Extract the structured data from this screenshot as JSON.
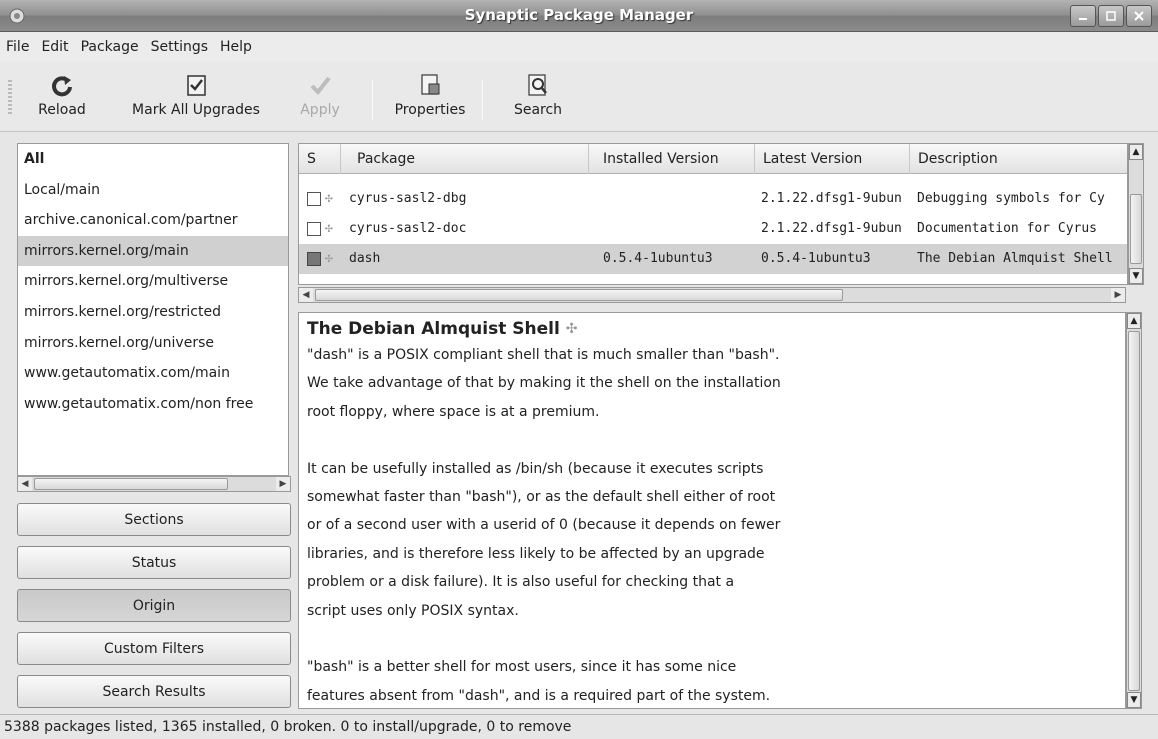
{
  "window": {
    "title": "Synaptic Package Manager"
  },
  "menubar": {
    "items": [
      "File",
      "Edit",
      "Package",
      "Settings",
      "Help"
    ]
  },
  "toolbar": {
    "reload": "Reload",
    "mark_all_upgrades": "Mark All Upgrades",
    "apply": "Apply",
    "properties": "Properties",
    "search": "Search"
  },
  "origins": {
    "selected": "mirrors.kernel.org/main",
    "items": [
      "All",
      "Local/main",
      "archive.canonical.com/partner",
      "mirrors.kernel.org/main",
      "mirrors.kernel.org/multiverse",
      "mirrors.kernel.org/restricted",
      "mirrors.kernel.org/universe",
      "www.getautomatix.com/main",
      "www.getautomatix.com/non free"
    ]
  },
  "filter_buttons": [
    "Sections",
    "Status",
    "Origin",
    "Custom Filters",
    "Search Results"
  ],
  "active_filter": "Origin",
  "packages": {
    "columns": [
      "S",
      "Package",
      "Installed Version",
      "Latest Version",
      "Description"
    ],
    "rows": [
      {
        "name": "cyrus-sasl2-dbg",
        "installed": "",
        "latest": "2.1.22.dfsg1-9ubun",
        "description": "Debugging symbols for Cy",
        "status": "not-installed"
      },
      {
        "name": "cyrus-sasl2-doc",
        "installed": "",
        "latest": "2.1.22.dfsg1-9ubun",
        "description": "Documentation for Cyrus",
        "status": "not-installed"
      },
      {
        "name": "dash",
        "installed": "0.5.4-1ubuntu3",
        "latest": "0.5.4-1ubuntu3",
        "description": "The Debian Almquist Shell",
        "status": "installed"
      }
    ]
  },
  "description": {
    "title": "The Debian Almquist Shell",
    "lines": [
      "\"dash\" is a POSIX compliant shell that is much smaller than \"bash\".",
      "We take advantage of that by making it the shell on the installation",
      "root floppy, where space is at a premium.",
      "",
      "It can be usefully installed as /bin/sh (because it executes scripts",
      "somewhat faster than \"bash\"), or as the default shell either of root",
      "or of a second user with a userid of 0 (because it depends on fewer",
      "libraries, and is therefore less likely to be affected by an upgrade",
      "problem or a disk failure).  It is also useful for checking that a",
      "script uses only POSIX syntax.",
      "",
      "\"bash\" is a better shell for most users, since it has some nice",
      "features absent from \"dash\", and is a required part of the system."
    ]
  },
  "statusbar": {
    "text": "5388 packages listed, 1365 installed, 0 broken. 0 to install/upgrade, 0 to remove"
  }
}
